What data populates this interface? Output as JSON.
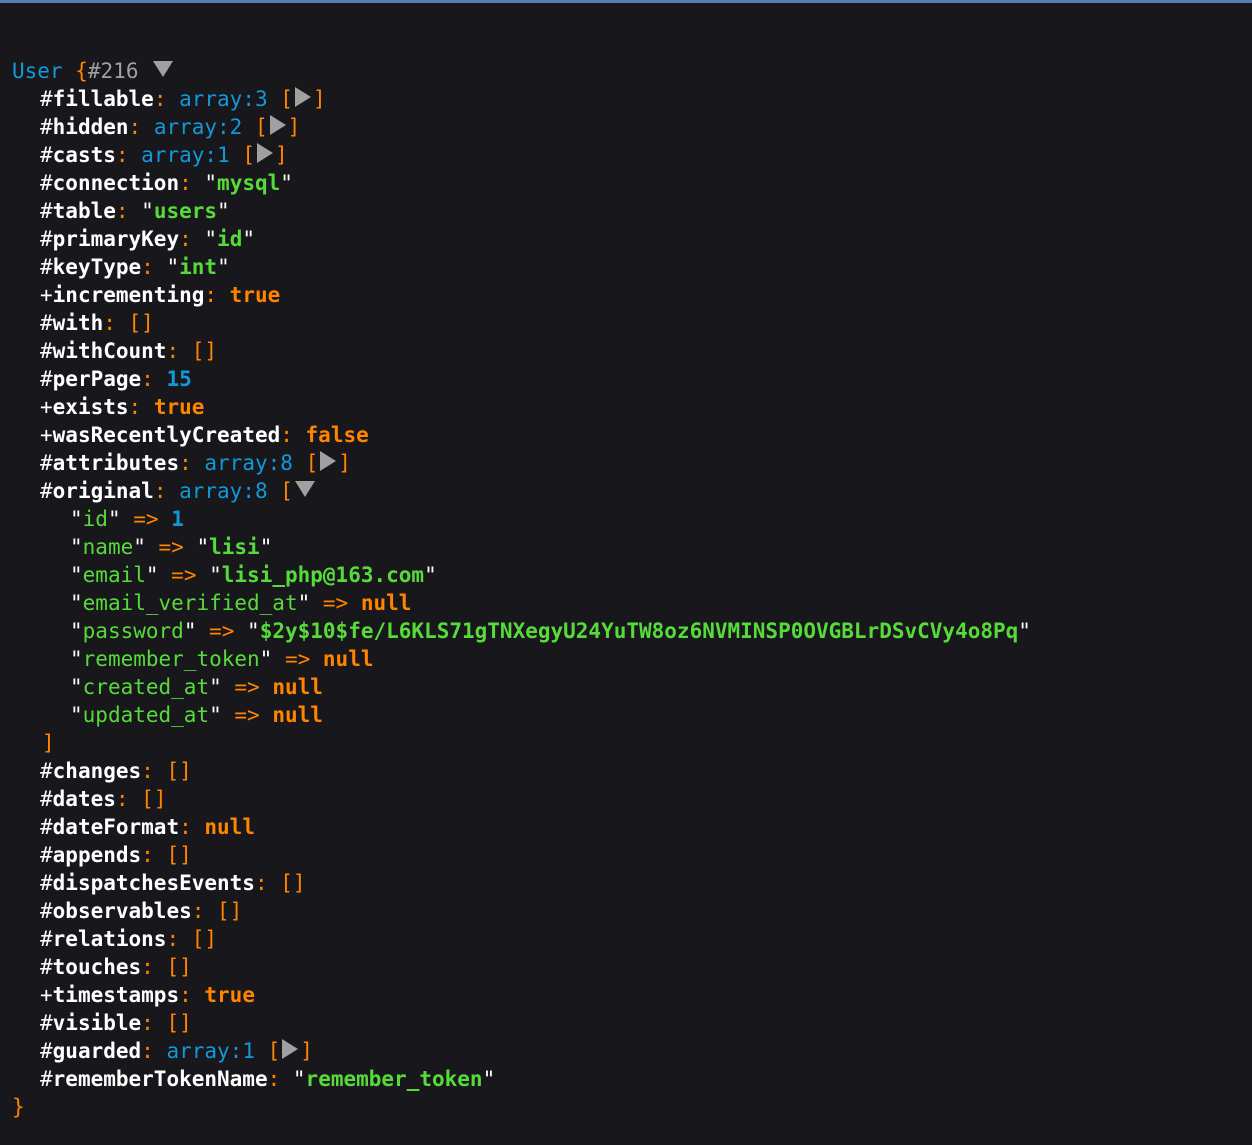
{
  "header": {
    "class_name": "User",
    "brace_open": "{",
    "ref_id": "#216",
    "brace_close": "}"
  },
  "props": [
    {
      "prefix": "#",
      "name": "fillable",
      "kind": "array",
      "note": "array:3",
      "expanded": false
    },
    {
      "prefix": "#",
      "name": "hidden",
      "kind": "array",
      "note": "array:2",
      "expanded": false
    },
    {
      "prefix": "#",
      "name": "casts",
      "kind": "array",
      "note": "array:1",
      "expanded": false
    },
    {
      "prefix": "#",
      "name": "connection",
      "kind": "string",
      "value": "mysql"
    },
    {
      "prefix": "#",
      "name": "table",
      "kind": "string",
      "value": "users"
    },
    {
      "prefix": "#",
      "name": "primaryKey",
      "kind": "string",
      "value": "id"
    },
    {
      "prefix": "#",
      "name": "keyType",
      "kind": "string",
      "value": "int"
    },
    {
      "prefix": "+",
      "name": "incrementing",
      "kind": "const",
      "value": "true"
    },
    {
      "prefix": "#",
      "name": "with",
      "kind": "empty",
      "value": "[]"
    },
    {
      "prefix": "#",
      "name": "withCount",
      "kind": "empty",
      "value": "[]"
    },
    {
      "prefix": "#",
      "name": "perPage",
      "kind": "num",
      "value": "15"
    },
    {
      "prefix": "+",
      "name": "exists",
      "kind": "const",
      "value": "true"
    },
    {
      "prefix": "+",
      "name": "wasRecentlyCreated",
      "kind": "const",
      "value": "false"
    },
    {
      "prefix": "#",
      "name": "attributes",
      "kind": "array",
      "note": "array:8",
      "expanded": false
    },
    {
      "prefix": "#",
      "name": "original",
      "kind": "array",
      "note": "array:8",
      "expanded": true
    },
    {
      "prefix": "#",
      "name": "changes",
      "kind": "empty",
      "value": "[]"
    },
    {
      "prefix": "#",
      "name": "dates",
      "kind": "empty",
      "value": "[]"
    },
    {
      "prefix": "#",
      "name": "dateFormat",
      "kind": "const",
      "value": "null"
    },
    {
      "prefix": "#",
      "name": "appends",
      "kind": "empty",
      "value": "[]"
    },
    {
      "prefix": "#",
      "name": "dispatchesEvents",
      "kind": "empty",
      "value": "[]"
    },
    {
      "prefix": "#",
      "name": "observables",
      "kind": "empty",
      "value": "[]"
    },
    {
      "prefix": "#",
      "name": "relations",
      "kind": "empty",
      "value": "[]"
    },
    {
      "prefix": "#",
      "name": "touches",
      "kind": "empty",
      "value": "[]"
    },
    {
      "prefix": "+",
      "name": "timestamps",
      "kind": "const",
      "value": "true"
    },
    {
      "prefix": "#",
      "name": "visible",
      "kind": "empty",
      "value": "[]"
    },
    {
      "prefix": "#",
      "name": "guarded",
      "kind": "array",
      "note": "array:1",
      "expanded": false
    },
    {
      "prefix": "#",
      "name": "rememberTokenName",
      "kind": "string",
      "value": "remember_token"
    }
  ],
  "original_items": [
    {
      "key": "id",
      "kind": "num",
      "value": "1"
    },
    {
      "key": "name",
      "kind": "string",
      "value": "lisi"
    },
    {
      "key": "email",
      "kind": "string",
      "value": "lisi_php@163.com"
    },
    {
      "key": "email_verified_at",
      "kind": "const",
      "value": "null"
    },
    {
      "key": "password",
      "kind": "string",
      "value": "$2y$10$fe/L6KLS71gTNXegyU24YuTW8oz6NVMINSP0OVGBLrDSvCVy4o8Pq"
    },
    {
      "key": "remember_token",
      "kind": "const",
      "value": "null"
    },
    {
      "key": "created_at",
      "kind": "const",
      "value": "null"
    },
    {
      "key": "updated_at",
      "kind": "const",
      "value": "null"
    }
  ],
  "original_close": "]",
  "tokens": {
    "colon": ": ",
    "arrow": " => ",
    "bracket_open": "[",
    "bracket_close": "]",
    "quote": "\"",
    "space": " "
  },
  "icons": {
    "collapsed": "triangle-right-icon",
    "expanded": "triangle-down-icon"
  },
  "colors": {
    "background": "#18171b",
    "class": "#1299da",
    "key": "#ffffff",
    "punctuation": "#ff8400",
    "string": "#56db3a",
    "number": "#1299da",
    "toggle": "#a0a0a0"
  }
}
